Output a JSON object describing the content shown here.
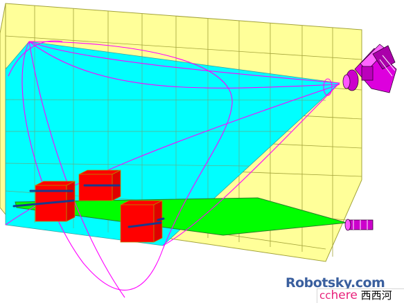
{
  "watermark": {
    "logo": "Robotsky.com",
    "cc": "cc",
    "here": "here",
    "cn": "西西河"
  },
  "colors": {
    "wall": "#ffff99",
    "grid": "#a3a33a",
    "field_of_view": "#00ffff",
    "ground_beam": "#00ff00",
    "blocks": "#ff0000",
    "outline": "#ff00ff",
    "sensor": "#cc00cc",
    "rail": "#1a3a8c"
  },
  "icons": [
    "camera-icon",
    "light-sensor-icon"
  ]
}
